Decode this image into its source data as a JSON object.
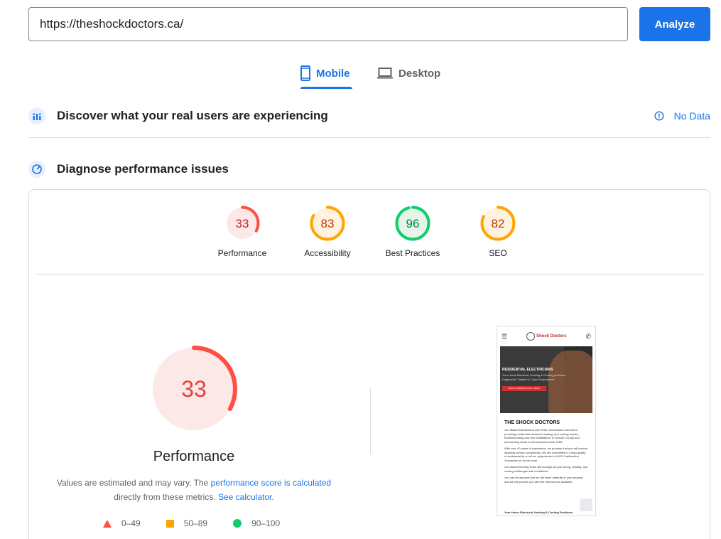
{
  "search": {
    "url": "https://theshockdoctors.ca/",
    "button": "Analyze"
  },
  "tabs": [
    {
      "label": "Mobile",
      "icon": "phone-icon",
      "active": true
    },
    {
      "label": "Desktop",
      "icon": "laptop-icon",
      "active": false
    }
  ],
  "discover": {
    "title": "Discover what your real users are experiencing",
    "status": "No Data"
  },
  "diagnose": {
    "title": "Diagnose performance issues"
  },
  "scores": [
    {
      "label": "Performance",
      "value": "33",
      "color": "#ff4e42"
    },
    {
      "label": "Accessibility",
      "value": "83",
      "color": "#ffa400"
    },
    {
      "label": "Best Practices",
      "value": "96",
      "color": "#0cce6b"
    },
    {
      "label": "SEO",
      "value": "82",
      "color": "#ffa400"
    }
  ],
  "performance": {
    "score": "33",
    "title": "Performance",
    "note_prefix": "Values are estimated and may vary. The ",
    "note_link1": "performance score is calculated",
    "note_middle": " directly from these metrics. ",
    "note_link2": "See calculator."
  },
  "legend": [
    {
      "range": "0–49",
      "color": "#ff4e42"
    },
    {
      "range": "50–89",
      "color": "#ffa400"
    },
    {
      "range": "90–100",
      "color": "#0cce6b"
    }
  ],
  "screenshot": {
    "hero_heading": "RESIDENTIAL ELECTRICIANS",
    "hero_text": "Your Home Electrical, Heating & Cooling problems Diagnosed, Treated & Cured Guaranteed",
    "hero_button": "BOOK A SERVICE CALL TODAY",
    "title": "THE SHOCK DOCTORS",
    "p1": "Our Master Electricians and HVAC Technicians have been providing residential electrical, heating, and cooling repairs, troubleshooting and new installations in Simcoe County and surrounding areas to homeowners since 1983.",
    "p2": "With over 40 years of experience, we promise that you will receive amazing service consistently. We are committed to a high quality of workmanship on all our projects and a 100% Satisfaction Guarantee on all our work.",
    "p3": "Our Award Winning Team will manage all your wiring, heating, and cooling challenges with confidence.",
    "p4": "You can be assured that we will listen carefully to your request, and we will provide you with the best service available.",
    "footer": "Your Home Electrical, Heating & Cooling Problems"
  }
}
